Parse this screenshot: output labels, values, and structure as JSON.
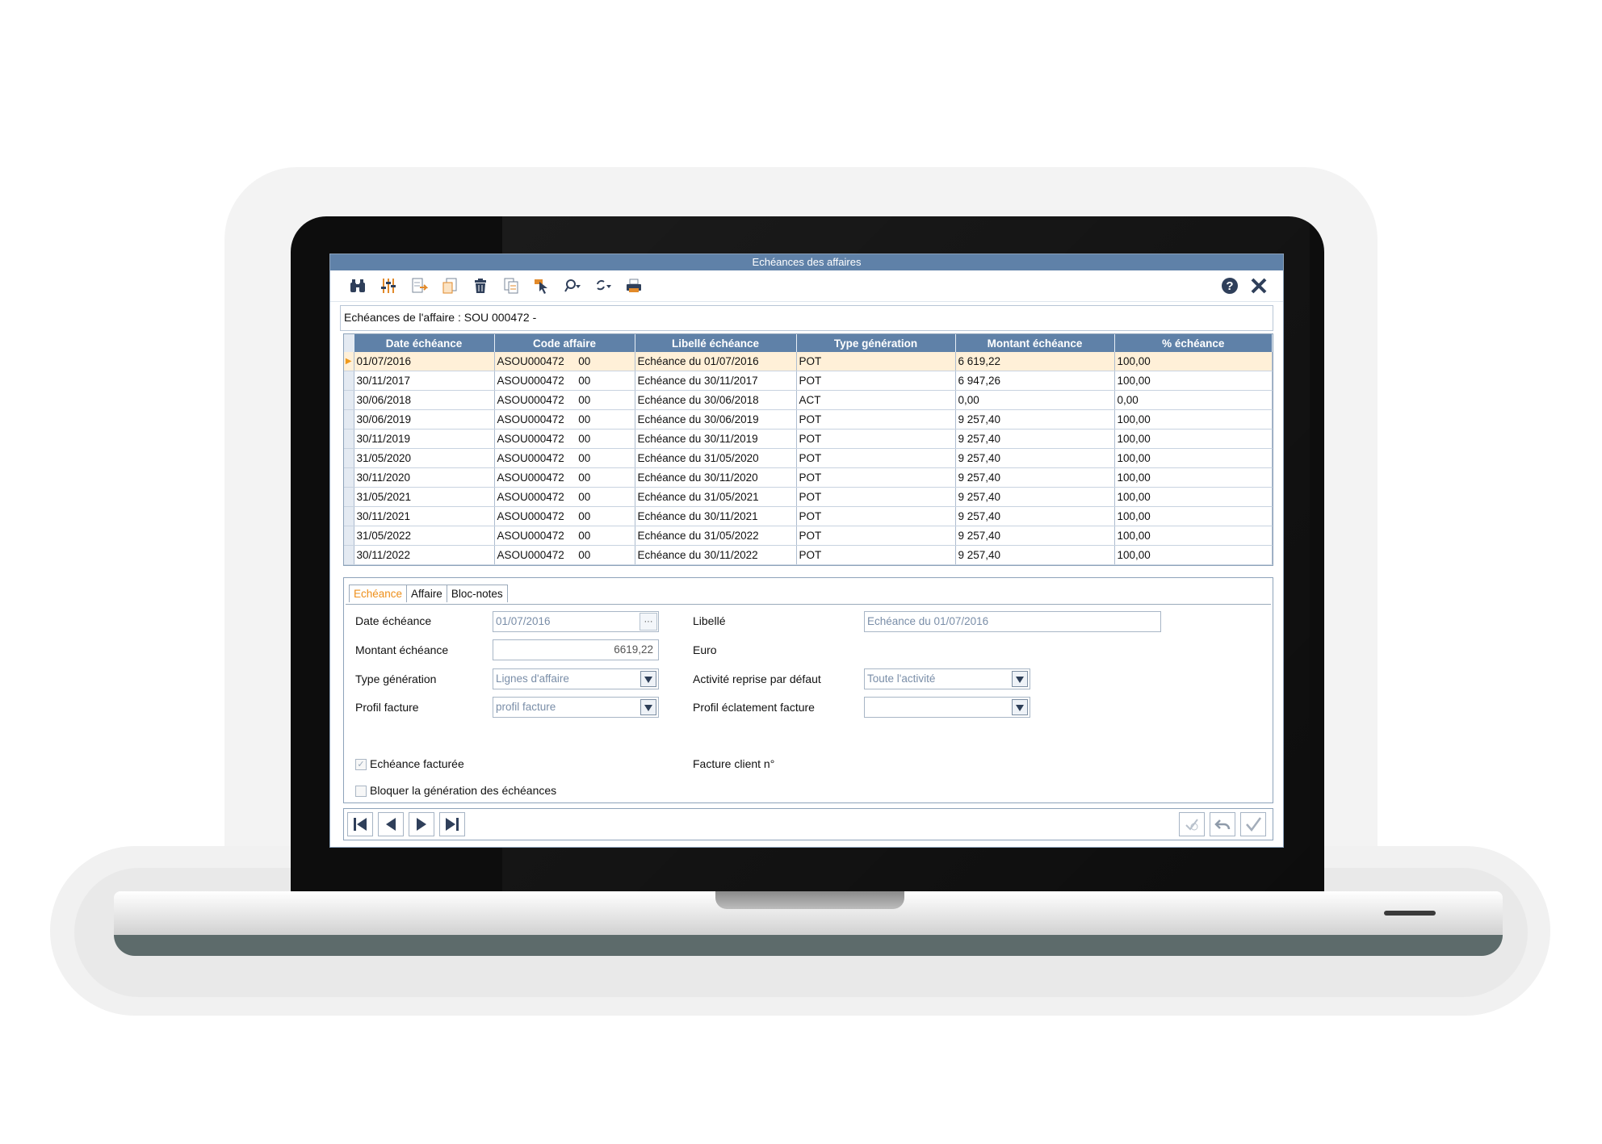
{
  "window": {
    "title": "Echéances des affaires"
  },
  "toolbar": {
    "icons": [
      "binoculars-icon",
      "filter-settings-icon",
      "export-icon",
      "copy-file-icon",
      "trash-icon",
      "duplicate-icon",
      "select-pointer-icon",
      "search-dropdown-icon",
      "refresh-dropdown-icon",
      "printer-icon"
    ],
    "right_icons": [
      "help-icon",
      "close-icon"
    ]
  },
  "info": {
    "text": "Echéances de l'affaire : SOU 000472 -"
  },
  "grid": {
    "columns": [
      "Date échéance",
      "Code affaire",
      "Libellé échéance",
      "Type génération",
      "Montant échéance",
      "% échéance"
    ],
    "rows": [
      {
        "date": "01/07/2016",
        "code": "ASOU000472",
        "sub": "00",
        "libelle": "Echéance du 01/07/2016",
        "type": "POT",
        "montant": "6 619,22",
        "pct": "100,00"
      },
      {
        "date": "30/11/2017",
        "code": "ASOU000472",
        "sub": "00",
        "libelle": "Echéance du 30/11/2017",
        "type": "POT",
        "montant": "6 947,26",
        "pct": "100,00"
      },
      {
        "date": "30/06/2018",
        "code": "ASOU000472",
        "sub": "00",
        "libelle": "Echéance du 30/06/2018",
        "type": "ACT",
        "montant": "0,00",
        "pct": "0,00"
      },
      {
        "date": "30/06/2019",
        "code": "ASOU000472",
        "sub": "00",
        "libelle": "Echéance du 30/06/2019",
        "type": "POT",
        "montant": "9 257,40",
        "pct": "100,00"
      },
      {
        "date": "30/11/2019",
        "code": "ASOU000472",
        "sub": "00",
        "libelle": "Echéance du 30/11/2019",
        "type": "POT",
        "montant": "9 257,40",
        "pct": "100,00"
      },
      {
        "date": "31/05/2020",
        "code": "ASOU000472",
        "sub": "00",
        "libelle": "Echéance du 31/05/2020",
        "type": "POT",
        "montant": "9 257,40",
        "pct": "100,00"
      },
      {
        "date": "30/11/2020",
        "code": "ASOU000472",
        "sub": "00",
        "libelle": "Echéance du 30/11/2020",
        "type": "POT",
        "montant": "9 257,40",
        "pct": "100,00"
      },
      {
        "date": "31/05/2021",
        "code": "ASOU000472",
        "sub": "00",
        "libelle": "Echéance du 31/05/2021",
        "type": "POT",
        "montant": "9 257,40",
        "pct": "100,00"
      },
      {
        "date": "30/11/2021",
        "code": "ASOU000472",
        "sub": "00",
        "libelle": "Echéance du 30/11/2021",
        "type": "POT",
        "montant": "9 257,40",
        "pct": "100,00"
      },
      {
        "date": "31/05/2022",
        "code": "ASOU000472",
        "sub": "00",
        "libelle": "Echéance du 31/05/2022",
        "type": "POT",
        "montant": "9 257,40",
        "pct": "100,00"
      },
      {
        "date": "30/11/2022",
        "code": "ASOU000472",
        "sub": "00",
        "libelle": "Echéance du 30/11/2022",
        "type": "POT",
        "montant": "9 257,40",
        "pct": "100,00"
      }
    ],
    "selected_row": 0
  },
  "tabs": [
    "Echéance",
    "Affaire",
    "Bloc-notes"
  ],
  "active_tab": "Echéance",
  "form": {
    "date_label": "Date échéance",
    "date_value": "01/07/2016",
    "date_button": "···",
    "montant_label": "Montant échéance",
    "montant_value": "6619,22",
    "currency": "Euro",
    "type_label": "Type génération",
    "type_value": "Lignes d'affaire",
    "profil_label": "Profil facture",
    "profil_value": "profil facture",
    "libelle_label": "Libellé",
    "libelle_value": "Echéance du 01/07/2016",
    "activite_label": "Activité reprise par défaut",
    "activite_value": "Toute l'activité",
    "eclatement_label": "Profil éclatement facture",
    "eclatement_value": "",
    "facturee_label": "Echéance facturée",
    "facturee_checked": true,
    "bloquer_label": "Bloquer la génération des échéances",
    "bloquer_checked": false,
    "facture_label": "Facture client n°",
    "check_mark": "✓"
  },
  "colors": {
    "header_blue": "#5f81a8",
    "selected_row": "#fff0d8",
    "active_tab": "#ee8f1a"
  },
  "nav": {
    "buttons": [
      "first-record-icon",
      "previous-record-icon",
      "next-record-icon",
      "last-record-icon"
    ],
    "right_buttons": [
      "validate-disabled-icon",
      "undo-icon",
      "confirm-icon"
    ]
  }
}
